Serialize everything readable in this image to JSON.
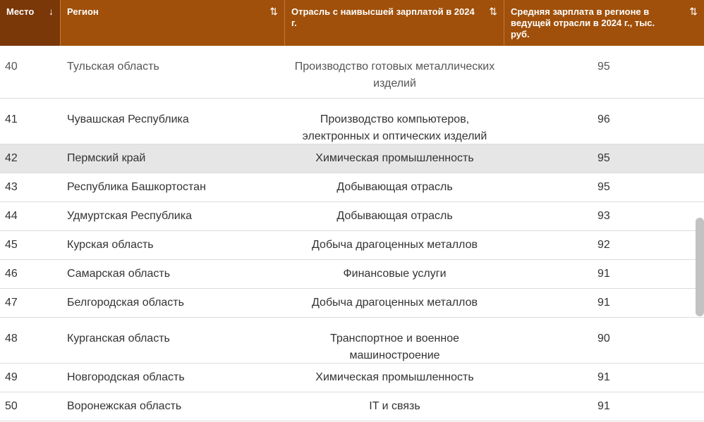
{
  "table": {
    "headers": [
      {
        "label": "Место",
        "sort_icon": "↓"
      },
      {
        "label": "Регион",
        "sort_icon": "⇅"
      },
      {
        "label": "Отрасль с наивысшей зарплатой в 2024 г.",
        "sort_icon": "⇅"
      },
      {
        "label": "Средняя зарплата в регионе в ведущей отрасли в 2024 г., тыс. руб.",
        "sort_icon": "⇅"
      }
    ],
    "rows": [
      {
        "rank": "40",
        "region": "Тульская область",
        "industry": "Производство готовых металлических изделий",
        "salary": "95"
      },
      {
        "rank": "41",
        "region": "Чувашская Республика",
        "industry": "Производство компьютеров, электронных и оптических изделий",
        "salary": "96"
      },
      {
        "rank": "42",
        "region": "Пермский край",
        "industry": "Химическая промышленность",
        "salary": "95"
      },
      {
        "rank": "43",
        "region": "Республика Башкортостан",
        "industry": "Добывающая отрасль",
        "salary": "95"
      },
      {
        "rank": "44",
        "region": "Удмуртская Республика",
        "industry": "Добывающая отрасль",
        "salary": "93"
      },
      {
        "rank": "45",
        "region": "Курская область",
        "industry": "Добыча драгоценных металлов",
        "salary": "92"
      },
      {
        "rank": "46",
        "region": "Самарская область",
        "industry": "Финансовые услуги",
        "salary": "91"
      },
      {
        "rank": "47",
        "region": "Белгородская область",
        "industry": "Добыча драгоценных металлов",
        "salary": "91"
      },
      {
        "rank": "48",
        "region": "Курганская область",
        "industry": "Транспортное и военное машиностроение",
        "salary": "90"
      },
      {
        "rank": "49",
        "region": "Новгородская область",
        "industry": "Химическая промышленность",
        "salary": "91"
      },
      {
        "rank": "50",
        "region": "Воронежская область",
        "industry": "IT и связь",
        "salary": "91"
      }
    ]
  },
  "colors": {
    "header_bg": "#a0500a",
    "header_active_bg": "#7a3708",
    "highlight_row_bg": "#e6e6e6"
  }
}
